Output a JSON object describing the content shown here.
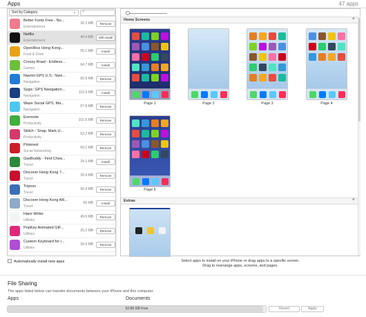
{
  "header": {
    "title": "Apps",
    "count": "47 apps"
  },
  "left_panel": {
    "sort_label": "Sort by Category",
    "search_placeholder": "",
    "apps": [
      {
        "name": "Better Fonts Free - No...",
        "category": "Entertainment",
        "size": "36.3 MB",
        "action": "Remove",
        "selected": false,
        "icon_color": "#f07b8a"
      },
      {
        "name": "Netflix",
        "category": "Entertainment",
        "size": "40.4 MB",
        "action": "Will Install",
        "selected": true,
        "icon_color": "#111111"
      },
      {
        "name": "OpenRice Hong Kong...",
        "category": "Food & Drink",
        "size": "55.1 MB",
        "action": "Install",
        "selected": false,
        "icon_color": "#e8a21a"
      },
      {
        "name": "Crossy Road - Endless...",
        "category": "Games",
        "size": "64.7 MB",
        "action": "Install",
        "selected": false,
        "icon_color": "#6cbf3a"
      },
      {
        "name": "Navmii GPS U.S.: Navi...",
        "category": "Navigation",
        "size": "82.9 MB",
        "action": "Remove",
        "selected": false,
        "icon_color": "#1f7bd6"
      },
      {
        "name": "Sygic: GPS Navigation...",
        "category": "Navigation",
        "size": "115.9 MB",
        "action": "Install",
        "selected": false,
        "icon_color": "#1c3f82"
      },
      {
        "name": "Waze Social GPS, Ma...",
        "category": "Navigation",
        "size": "67.8 MB",
        "action": "Remove",
        "selected": false,
        "icon_color": "#4cc8f0"
      },
      {
        "name": "Evernote",
        "category": "Productivity",
        "size": "101.6 MB",
        "action": "Remove",
        "selected": false,
        "icon_color": "#3fae3b"
      },
      {
        "name": "Skitch - Snap. Mark U...",
        "category": "Productivity",
        "size": "63.2 MB",
        "action": "Remove",
        "selected": false,
        "icon_color": "#d33a6a"
      },
      {
        "name": "Pinterest",
        "category": "Social Networking",
        "size": "69.2 MB",
        "action": "Remove",
        "selected": false,
        "icon_color": "#cb2027"
      },
      {
        "name": "GasBuddy - Find Chea...",
        "category": "Travel",
        "size": "24.1 MB",
        "action": "Install",
        "selected": false,
        "icon_color": "#2a8a3a"
      },
      {
        "name": "Discover Hong Kong 7...",
        "category": "Travel",
        "size": "30.4 MB",
        "action": "Remove",
        "selected": false,
        "icon_color": "#c8102e"
      },
      {
        "name": "Triposo",
        "category": "Travel",
        "size": "56.4 MB",
        "action": "Remove",
        "selected": false,
        "icon_color": "#3b6fb6"
      },
      {
        "name": "Discover Hong Kong AR...",
        "category": "Travel",
        "size": "65 MB",
        "action": "Install",
        "selected": false,
        "icon_color": "#8fa9c8"
      },
      {
        "name": "Hanx Writer",
        "category": "Utilities",
        "size": "49.9 MB",
        "action": "Remove",
        "selected": false,
        "icon_color": "#f4f4f4"
      },
      {
        "name": "PopKey Animated GIF...",
        "category": "Utilities",
        "size": "25.2 MB",
        "action": "Remove",
        "selected": false,
        "icon_color": "#e0287a"
      },
      {
        "name": "Custom Keyboard for i...",
        "category": "Utilities",
        "size": "34.9 MB",
        "action": "Remove",
        "selected": false,
        "icon_color": "#b04dd6"
      }
    ],
    "auto_install_label": "Automatically install new apps"
  },
  "right_panel": {
    "home_screens_label": "Home Screens",
    "extras_label": "Extras",
    "add_icon": "plus-icon",
    "pages": [
      "Page 1",
      "Page 2",
      "Page 3",
      "Page 4",
      "Page 5"
    ],
    "hint_line1": "Select apps to install on your iPhone or drag apps to a specific screen.",
    "hint_line2": "Drag to rearrange apps, screens, and pages."
  },
  "file_sharing": {
    "title": "File Sharing",
    "description": "The apps listed below can transfer documents between your iPhone and this computer.",
    "apps_header": "Apps",
    "documents_header": "Documents"
  },
  "footer": {
    "capacity_text": "52.85 GB Free",
    "capacity_used_fraction": 0.99,
    "revert_label": "Revert",
    "apply_label": "Apply"
  }
}
